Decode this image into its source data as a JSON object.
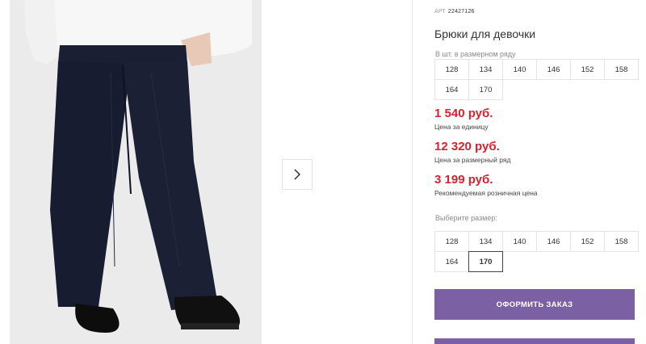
{
  "product": {
    "art_label": "АРТ",
    "art_number": "22427126",
    "title": "Брюки для девочки"
  },
  "row_sizes": {
    "caption": "В шт. в размерном ряду",
    "sizes": [
      "128",
      "134",
      "140",
      "146",
      "152",
      "158",
      "164",
      "170"
    ]
  },
  "prices": [
    {
      "value": "1 540 руб.",
      "label": "Цена за единицу"
    },
    {
      "value": "12 320 руб.",
      "label": "Цена за размерный ряд"
    },
    {
      "value": "3 199 руб.",
      "label": "Рекомендуемая розничная цена"
    }
  ],
  "size_select": {
    "caption": "Выберите размер:",
    "sizes": [
      "128",
      "134",
      "140",
      "146",
      "152",
      "158",
      "164",
      "170"
    ],
    "selected": "170"
  },
  "actions": {
    "order_label": "ОФОРМИТЬ ЗАКАЗ"
  },
  "icons": {
    "next": "chevron-right-icon"
  },
  "colors": {
    "price": "#d4232f",
    "button": "#7b60a3"
  }
}
